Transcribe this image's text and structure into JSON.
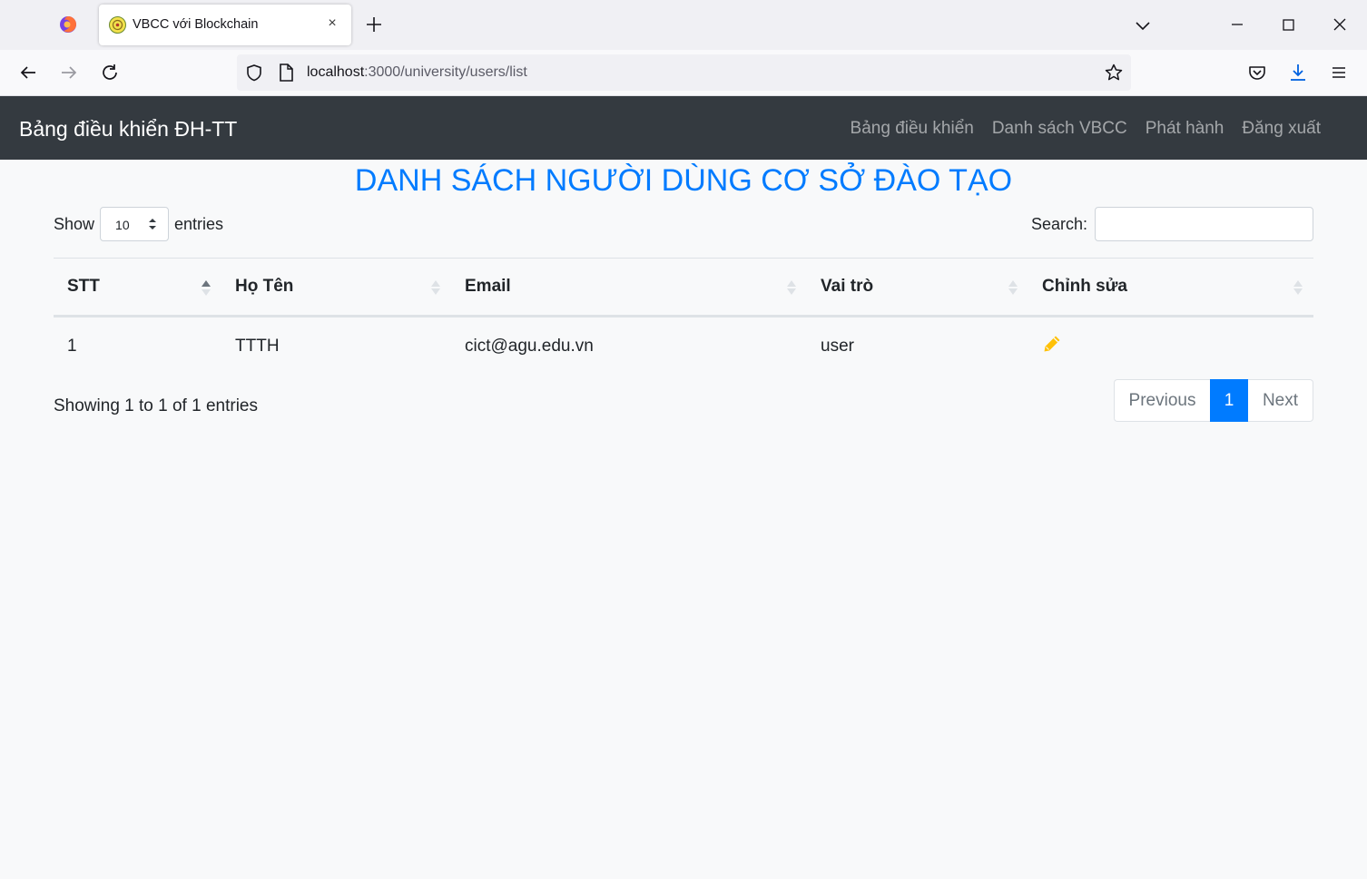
{
  "browser": {
    "tab_title": "VBCC với Blockchain",
    "tab_close": "×",
    "url_host": "localhost",
    "url_rest": ":3000/university/users/list"
  },
  "nav": {
    "brand": "Bảng điều khiển ĐH-TT",
    "links": [
      "Bảng điều khiển",
      "Danh sách VBCC",
      "Phát hành",
      "Đăng xuất"
    ]
  },
  "page": {
    "title": "DANH SÁCH NGƯỜI DÙNG CƠ SỞ ĐÀO TẠO"
  },
  "controls": {
    "show_label": "Show",
    "entries_label": "entries",
    "length_value": "10",
    "search_label": "Search:",
    "search_value": ""
  },
  "table": {
    "columns": [
      "STT",
      "Họ Tên",
      "Email",
      "Vai trò",
      "Chỉnh sửa"
    ],
    "rows": [
      {
        "stt": "1",
        "name": "TTTH",
        "email": "cict@agu.edu.vn",
        "role": "user",
        "edit_icon": "pencil-icon"
      }
    ]
  },
  "footer": {
    "info": "Showing 1 to 1 of 1 entries",
    "previous": "Previous",
    "page": "1",
    "next": "Next"
  },
  "colors": {
    "navbar_bg": "#343a40",
    "primary": "#007bff",
    "edit_icon": "#ffc107"
  }
}
